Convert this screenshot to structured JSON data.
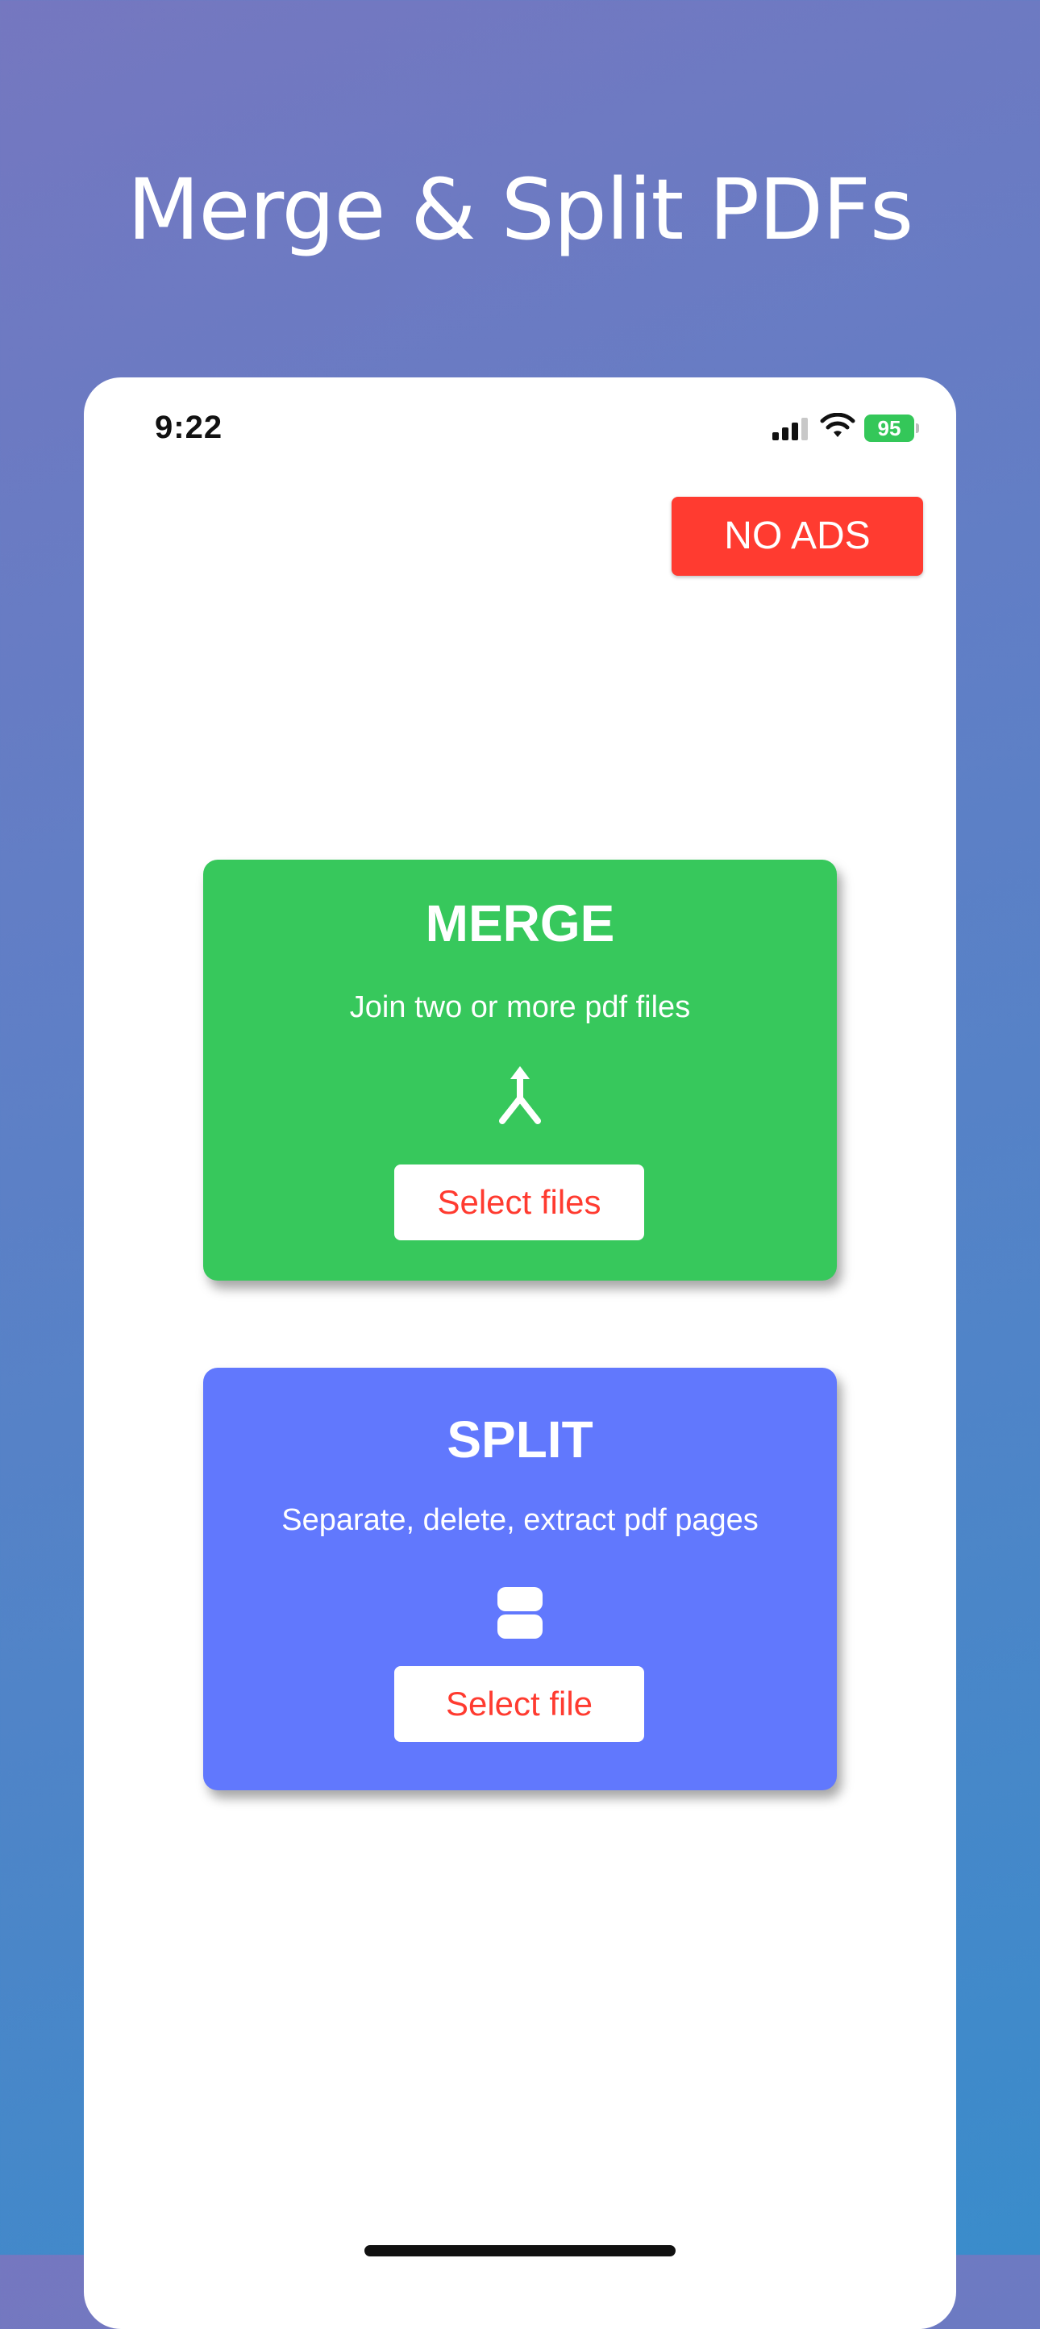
{
  "headline": "Merge & Split PDFs",
  "status_bar": {
    "time": "9:22",
    "battery_level": "95",
    "battery_color": "#34c759",
    "icons": [
      "cellular-signal-icon",
      "wifi-icon",
      "battery-icon"
    ]
  },
  "no_ads_button": {
    "label": "NO ADS",
    "color": "#ff3b30"
  },
  "merge_card": {
    "title": "MERGE",
    "description": "Join two or more pdf files",
    "icon": "merge-arrow-icon",
    "button_label": "Select files",
    "background": "#37c85c"
  },
  "split_card": {
    "title": "SPLIT",
    "description": "Separate, delete, extract pdf pages",
    "icon": "split-page-icon",
    "button_label": "Select file",
    "background": "#6178fd"
  }
}
